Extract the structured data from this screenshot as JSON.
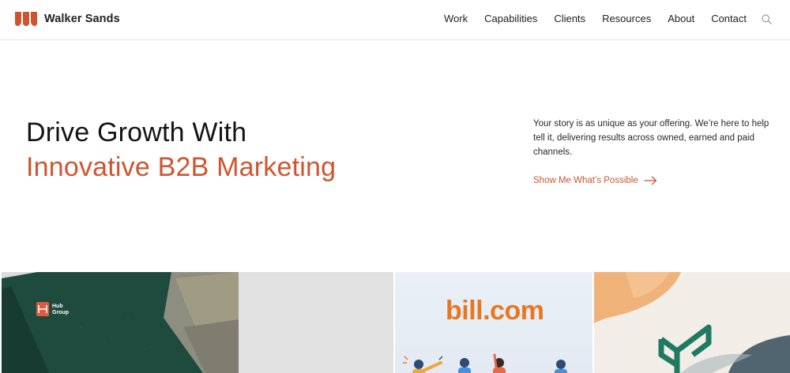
{
  "brand": {
    "name": "Walker Sands",
    "accent": "#d0542f"
  },
  "nav": {
    "items": [
      {
        "label": "Work"
      },
      {
        "label": "Capabilities"
      },
      {
        "label": "Clients"
      },
      {
        "label": "Resources"
      },
      {
        "label": "About"
      },
      {
        "label": "Contact"
      }
    ],
    "search_icon": "search-icon"
  },
  "hero": {
    "line1": "Drive Growth With",
    "line2": "Innovative B2B Marketing",
    "body": "Your story is as unique as your offering. We’re here to help tell it, delivering results across owned, earned and paid channels.",
    "cta_label": "Show Me What’s Possible",
    "cta_icon": "arrow-right-icon"
  },
  "cards": [
    {
      "name": "hub-group-card",
      "brand_text": "Hub Group"
    },
    {
      "name": "bill-com-card",
      "brand_text": "bill.com"
    },
    {
      "name": "leaf-brand-card",
      "brand_text": ""
    }
  ]
}
